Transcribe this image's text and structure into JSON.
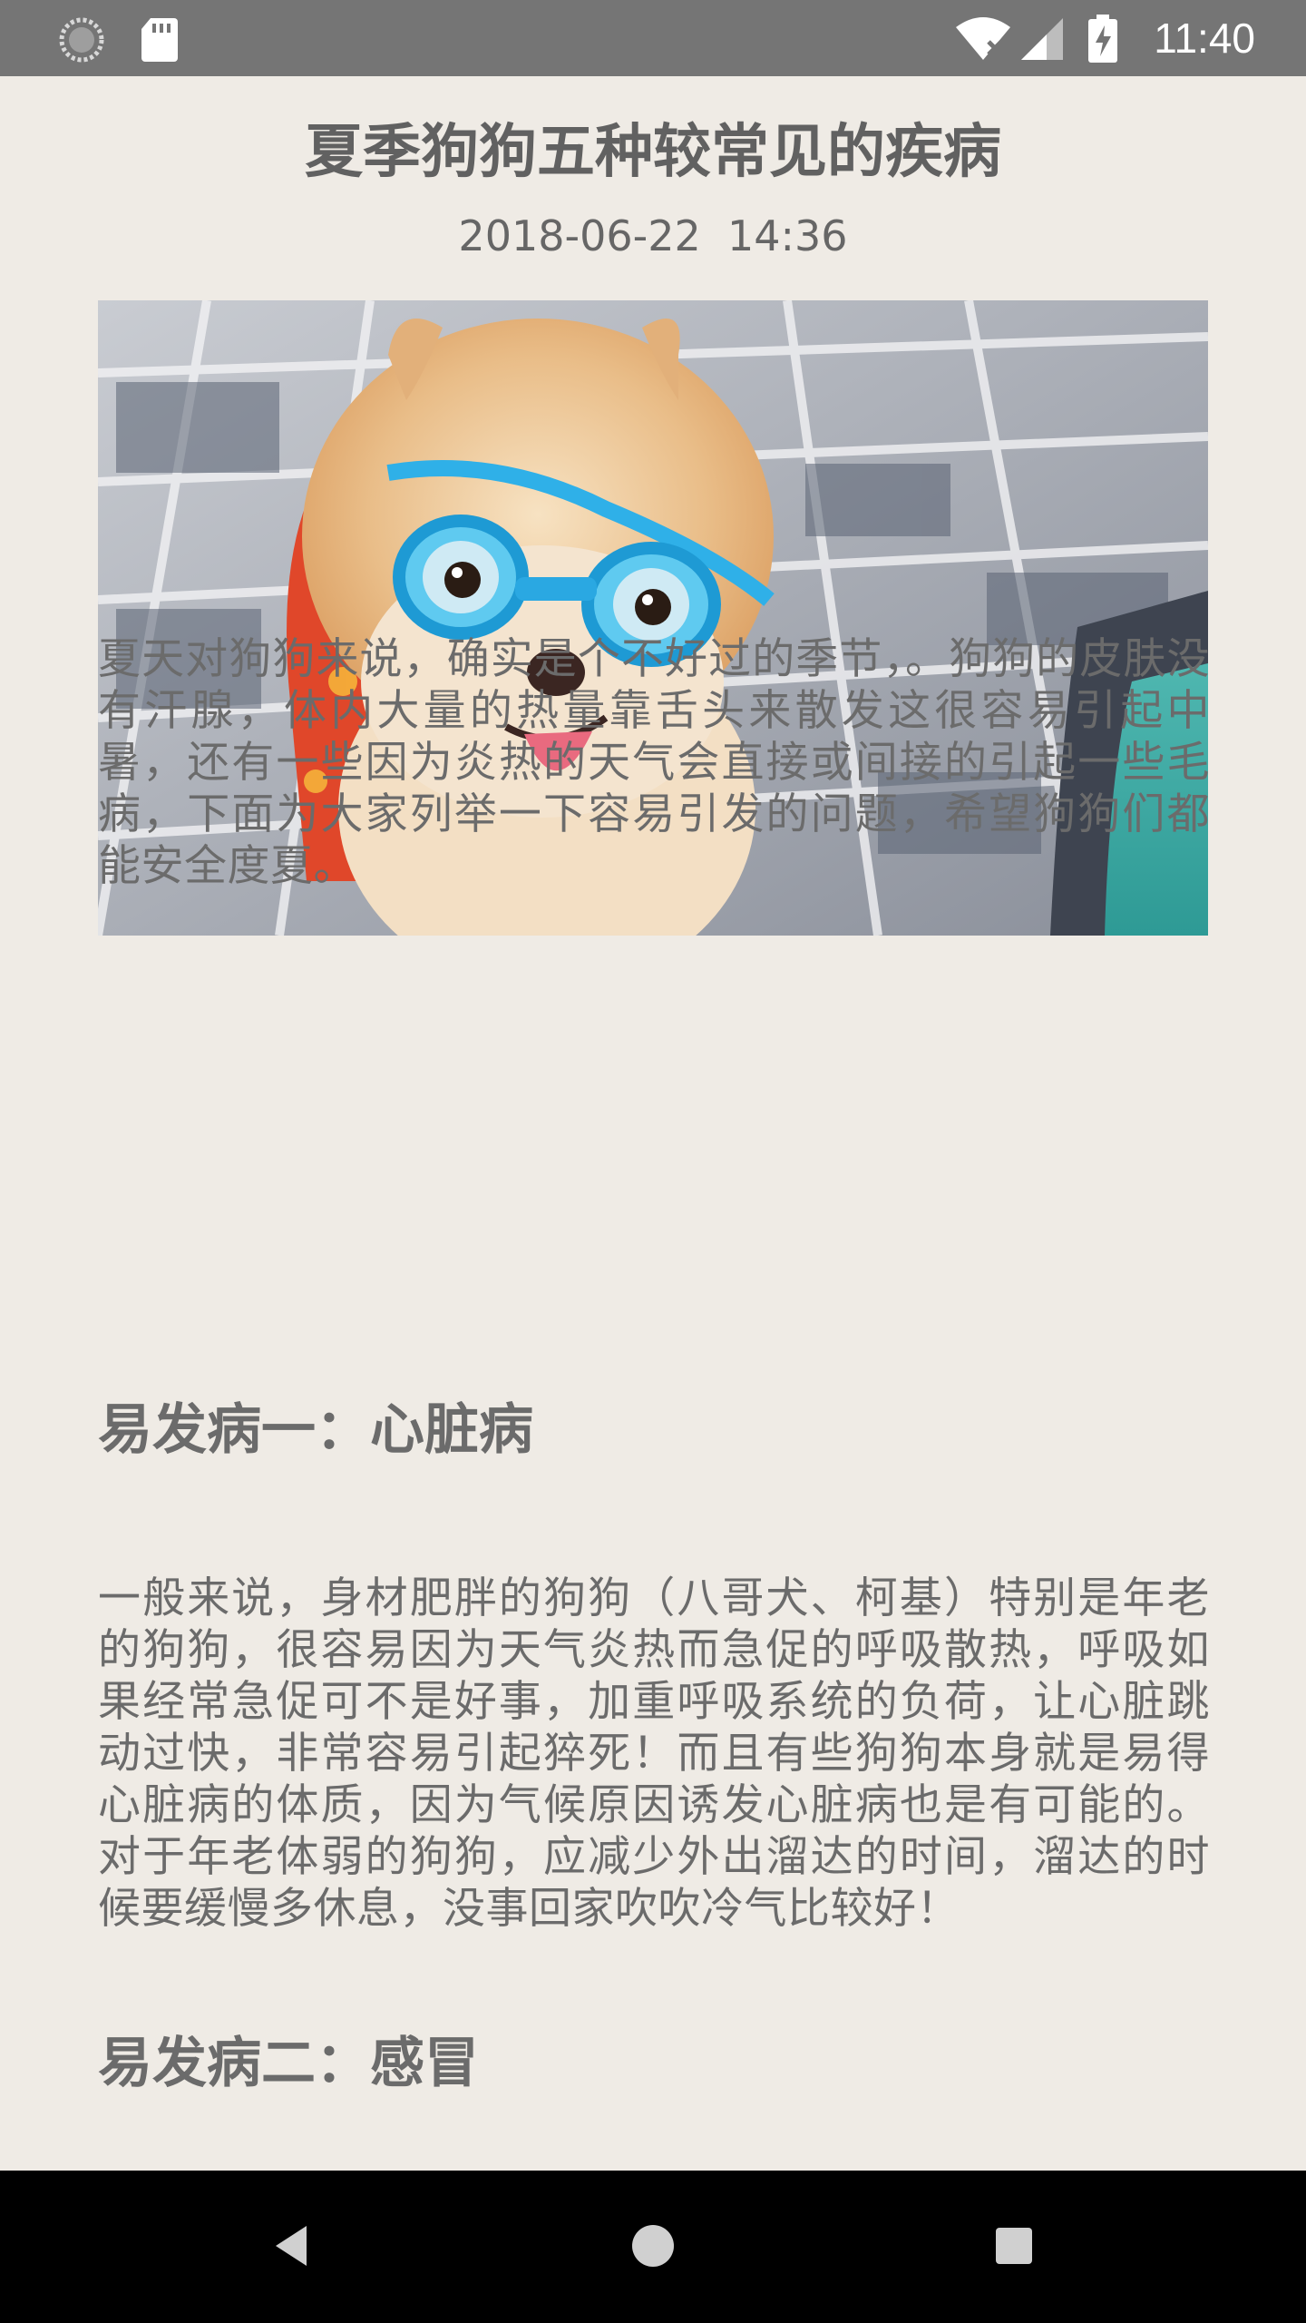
{
  "status_bar": {
    "time": "11:40",
    "left_icons": [
      "sync-circle-icon",
      "sd-card-icon"
    ],
    "right_icons": [
      "wifi-no-internet-icon",
      "cell-signal-icon",
      "battery-charging-icon"
    ]
  },
  "article": {
    "title": "夏季狗狗五种较常见的疾病",
    "date": "2018-06-22  14:36",
    "image": {
      "name": "pomeranian-wearing-goggles-photo"
    },
    "intro": "夏天对狗狗来说，确实是个不好过的季节，。狗狗的皮肤没有汗腺，体内大量的热量靠舌头来散发这很容易引起中暑，还有一些因为炎热的天气会直接或间接的引起一些毛病，下面为大家列举一下容易引发的问题，希望狗狗们都能安全度夏。",
    "sections": [
      {
        "heading": "易发病一：心脏病",
        "body": "一般来说，身材肥胖的狗狗（八哥犬、柯基）特别是年老的狗狗，很容易因为天气炎热而急促的呼吸散热，呼吸如果经常急促可不是好事，加重呼吸系统的负荷，让心脏跳动过快，非常容易引起猝死！而且有些狗狗本身就是易得心脏病的体质，因为气候原因诱发心脏病也是有可能的。对于年老体弱的狗狗，应减少外出溜达的时间，溜达的时候要缓慢多休息，没事回家吹吹冷气比较好！"
      },
      {
        "heading": "易发病二：感冒"
      }
    ]
  },
  "nav_bar": {
    "buttons": [
      "back-icon",
      "home-icon",
      "recents-icon"
    ]
  },
  "colors": {
    "status_bar": "#757575",
    "background": "#efebe5",
    "text": "#6b6b6b",
    "nav_bar": "#000000"
  }
}
